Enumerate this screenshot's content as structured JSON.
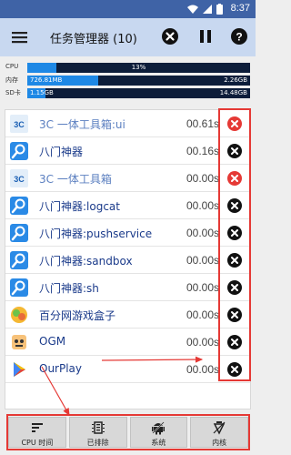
{
  "statusbar": {
    "time": "8:37"
  },
  "appbar": {
    "title": "任务管理器 (10)"
  },
  "usage": {
    "cpu": {
      "label": "CPU",
      "center": "13%",
      "fraction": 0.13
    },
    "mem": {
      "label": "内存",
      "used": "726.81MB",
      "total": "2.26GB",
      "fraction": 0.32
    },
    "sd": {
      "label": "SD卡",
      "used": "1.15GB",
      "total": "14.48GB",
      "fraction": 0.08
    }
  },
  "apps": [
    {
      "name": "3C 一体工具箱:ui",
      "time": "00.61s",
      "icon": "3c-toolbox-icon",
      "faded": true,
      "kill_red": true
    },
    {
      "name": "八门神器",
      "time": "00.16s",
      "icon": "bamen-icon",
      "faded": false,
      "kill_red": false
    },
    {
      "name": "3C 一体工具箱",
      "time": "00.00s",
      "icon": "3c-toolbox-icon",
      "faded": true,
      "kill_red": true
    },
    {
      "name": "八门神器:logcat",
      "time": "00.00s",
      "icon": "bamen-icon",
      "faded": false,
      "kill_red": false
    },
    {
      "name": "八门神器:pushservice",
      "time": "00.00s",
      "icon": "bamen-icon",
      "faded": false,
      "kill_red": false
    },
    {
      "name": "八门神器:sandbox",
      "time": "00.00s",
      "icon": "bamen-icon",
      "faded": false,
      "kill_red": false
    },
    {
      "name": "八门神器:sh",
      "time": "00.00s",
      "icon": "bamen-icon",
      "faded": false,
      "kill_red": false
    },
    {
      "name": "百分网游戏盒子",
      "time": "00.00s",
      "icon": "baifen-icon",
      "faded": false,
      "kill_red": false
    },
    {
      "name": "OGM",
      "time": "00.00s",
      "icon": "ogm-icon",
      "faded": false,
      "kill_red": false
    },
    {
      "name": "OurPlay",
      "time": "00.00s",
      "icon": "ourplay-icon",
      "faded": false,
      "kill_red": false
    }
  ],
  "bottom": {
    "cpu_time": "CPU 时间",
    "excluded": "已排除",
    "system": "系统",
    "kernel": "内核"
  },
  "colors": {
    "statusbar": "#3f63a6",
    "appbar": "#c8d8f0",
    "accent": "#1e88e5",
    "annotation": "#e53935"
  }
}
